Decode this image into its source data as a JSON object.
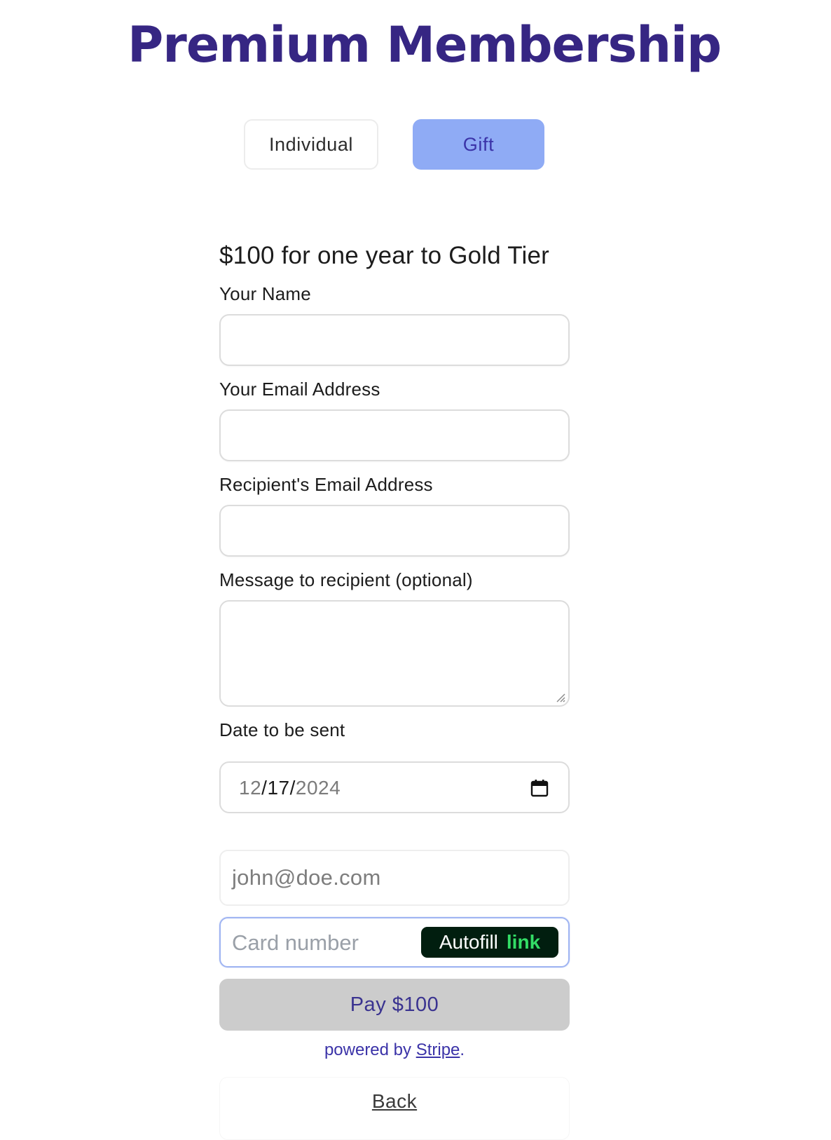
{
  "header": {
    "title": "Premium Membership"
  },
  "tabs": {
    "individual": "Individual",
    "gift": "Gift",
    "selected": "Gift",
    "selected_color": "#8fabf5"
  },
  "form": {
    "plan_text": "$100 for one year to Gold Tier",
    "your_name_label": "Your Name",
    "your_name_value": "",
    "your_email_label": "Your Email Address",
    "your_email_value": "",
    "recipient_email_label": "Recipient's Email Address",
    "recipient_email_value": "",
    "message_label": "Message to recipient (optional)",
    "message_value": "",
    "date_label": "Date to be sent",
    "date": {
      "month": "12",
      "day": "17",
      "year": "2024"
    }
  },
  "payment": {
    "email_placeholder": "john@doe.com",
    "card_placeholder": "Card number",
    "autofill_label": "Autofill",
    "autofill_link_word": "link",
    "pay_label": "Pay $100",
    "powered_prefix": "powered by",
    "stripe_label": "Stripe",
    "powered_suffix": "."
  },
  "footer": {
    "back_label": "Back"
  },
  "colors": {
    "title": "#362683",
    "accent_text": "#3b33a8",
    "link_green": "#33dd66",
    "autofill_bg": "#011e0f"
  }
}
